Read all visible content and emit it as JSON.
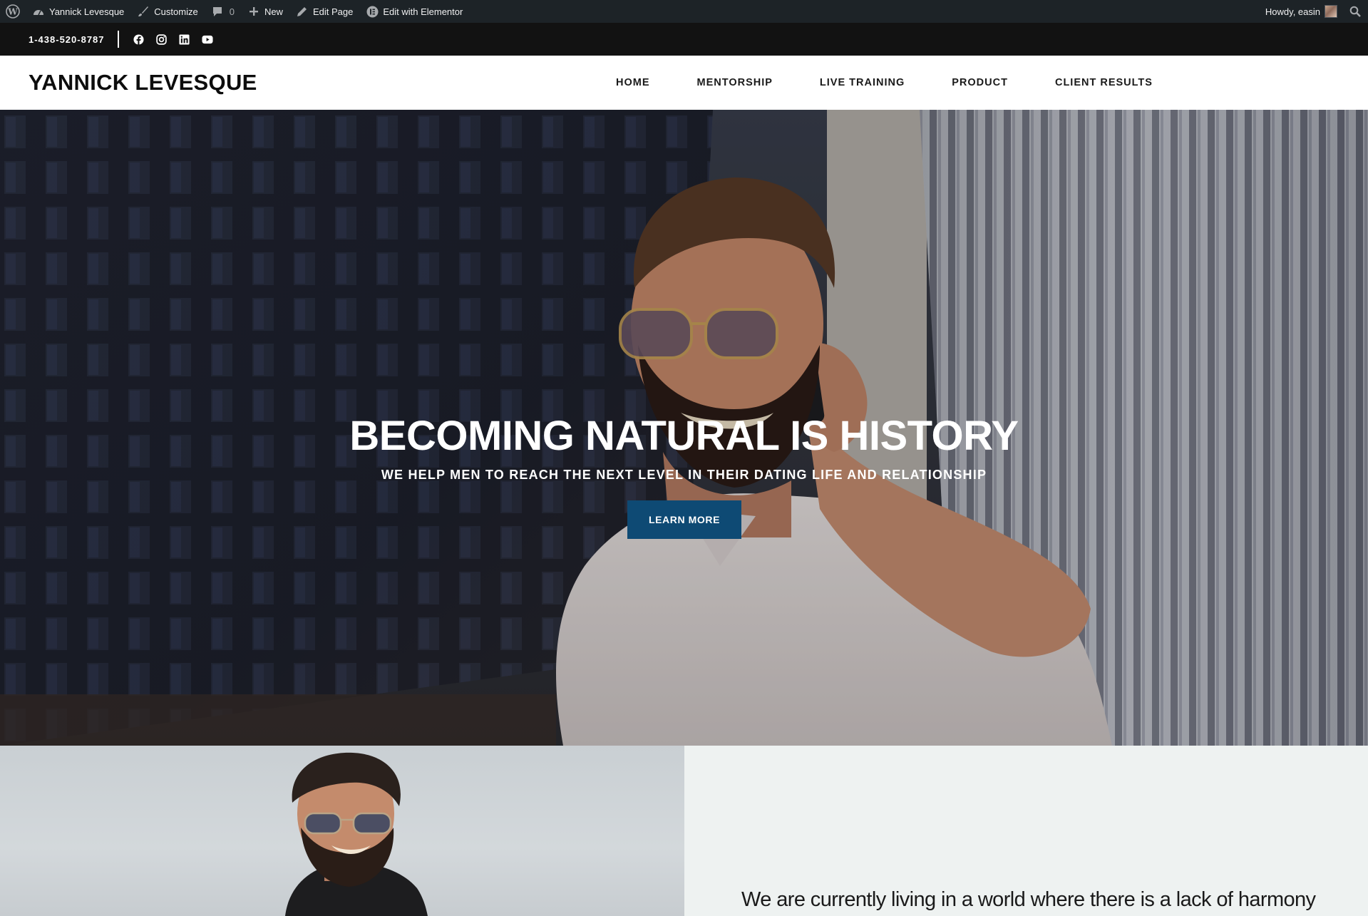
{
  "admin_bar": {
    "site_name": "Yannick Levesque",
    "customize": "Customize",
    "comments_count": "0",
    "new": "New",
    "edit_page": "Edit Page",
    "edit_elementor": "Edit with Elementor",
    "greeting": "Howdy, easin"
  },
  "top_bar": {
    "phone": "1-438-520-8787",
    "social_icons": [
      "facebook-icon",
      "instagram-icon",
      "linkedin-icon",
      "youtube-icon"
    ]
  },
  "header": {
    "logo": "YANNICK LEVESQUE",
    "nav": [
      {
        "label": "HOME"
      },
      {
        "label": "MENTORSHIP"
      },
      {
        "label": "LIVE TRAINING"
      },
      {
        "label": "PRODUCT"
      },
      {
        "label": "CLIENT RESULTS"
      }
    ]
  },
  "hero": {
    "title": "BECOMING NATURAL IS HISTORY",
    "subtitle": "WE HELP MEN TO REACH THE NEXT LEVEL IN THEIR DATING LIFE AND RELATIONSHIP",
    "button": "LEARN MORE"
  },
  "about": {
    "lead": "We are currently living in a world where there is a lack of harmony"
  },
  "colors": {
    "admin_bar_bg": "#1d2327",
    "top_bar_bg": "#121212",
    "button_bg": "#0e4a74",
    "about_text_bg": "#eef2f1"
  }
}
